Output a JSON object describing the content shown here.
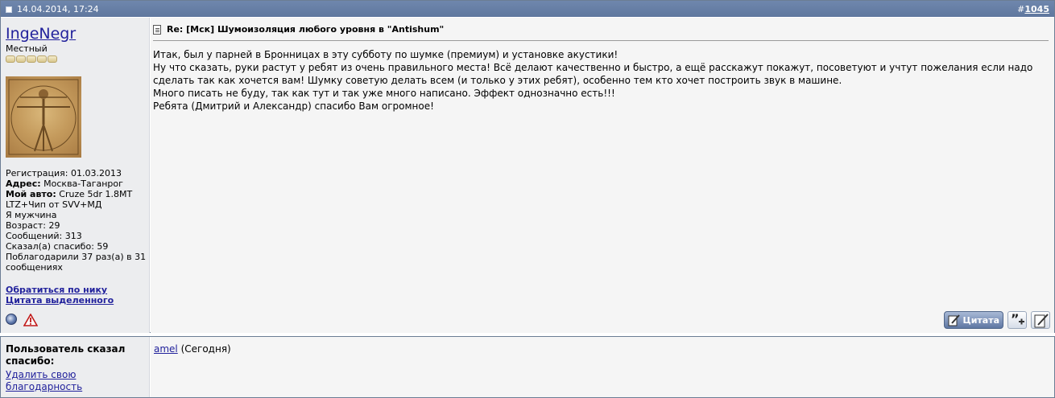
{
  "post": {
    "datetime": "14.04.2014, 17:24",
    "post_number_prefix": "#",
    "post_number": "1045",
    "user": {
      "username": "IngeNegr",
      "title": "Местный",
      "info": {
        "reg_label": "Регистрация:",
        "reg_value": "01.03.2013",
        "address_label": "Адрес:",
        "address_value": "Москва-Таганрог",
        "car_label": "Мой авто:",
        "car_value": "Cruze 5dr 1.8MT LTZ+Чип от SVV+МД",
        "gender": "Я мужчина",
        "age": "Возраст: 29",
        "messages": "Сообщений: 313",
        "said_thanks": "Сказал(а) спасибо: 59",
        "thanked": "Поблагодарили 37 раз(а) в 31 сообщениях"
      },
      "links": {
        "address_by_nick": "Обратиться по нику",
        "quote_selected": "Цитата выделенного"
      }
    },
    "message": {
      "title": "Re: [Мск] Шумоизоляция любого уровня в \"Antishum\"",
      "lines": [
        "Итак, был у парней в Бронницах в эту субботу по шумке (премиум) и установке акустики!",
        "Ну что сказать, руки растут у ребят из очень правильного места! Всё делают качественно и быстро, а ещё расскажут покажут, посоветуют и учтут пожелания если надо сделать так как хочется вам! Шумку советую делать всем (и только у этих ребят), особенно тем кто хочет построить звук в машине.",
        "Много писать не буду, так как тут и так уже много написано. Эффект однозначно есть!!!",
        "Ребята (Дмитрий и Александр) спасибо Вам огромное!"
      ]
    },
    "buttons": {
      "quote_label": "Цитата"
    }
  },
  "thanks": {
    "label": "Пользователь сказал спасибо:",
    "remove_link": "Удалить свою благодарность",
    "user": "amel",
    "when": " (Сегодня)"
  },
  "colors": {
    "header_bg": "#6a82a9",
    "link": "#22229c",
    "user_pane_bg": "#ecedef",
    "message_bg": "#f5f5f5"
  }
}
